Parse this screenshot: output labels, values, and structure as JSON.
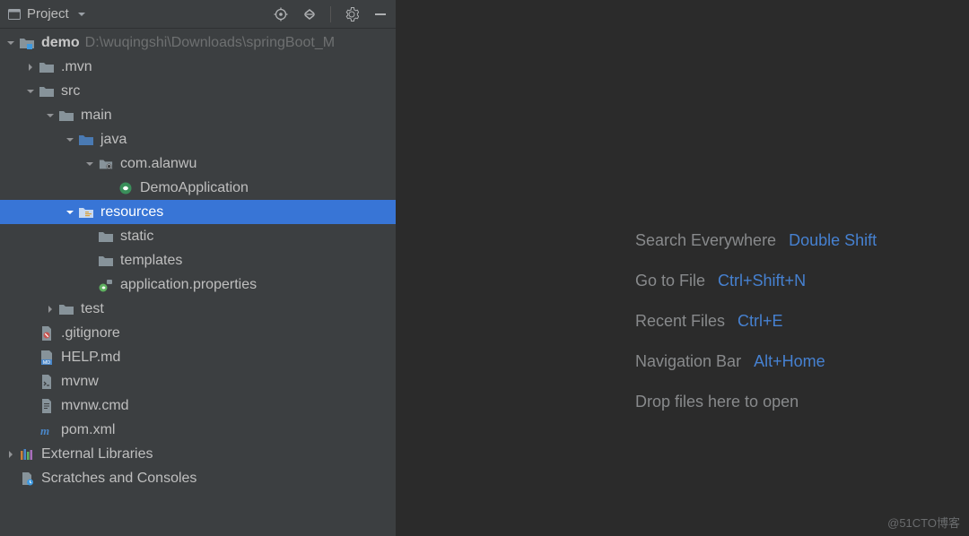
{
  "toolbar": {
    "title": "Project"
  },
  "tree": [
    {
      "indent": 0,
      "caret": "down",
      "iconKey": "module-folder",
      "label": "demo",
      "bold": true,
      "path": "D:\\wuqingshi\\Downloads\\springBoot_M"
    },
    {
      "indent": 1,
      "caret": "right",
      "iconKey": "folder",
      "label": ".mvn"
    },
    {
      "indent": 1,
      "caret": "down",
      "iconKey": "folder",
      "label": "src"
    },
    {
      "indent": 2,
      "caret": "down",
      "iconKey": "folder",
      "label": "main"
    },
    {
      "indent": 3,
      "caret": "down",
      "iconKey": "source-folder",
      "label": "java"
    },
    {
      "indent": 4,
      "caret": "down",
      "iconKey": "package",
      "label": "com.alanwu"
    },
    {
      "indent": 5,
      "caret": "none",
      "iconKey": "spring-class",
      "label": "DemoApplication"
    },
    {
      "indent": 3,
      "caret": "down",
      "iconKey": "resources-folder",
      "label": "resources",
      "selected": true
    },
    {
      "indent": 4,
      "caret": "none",
      "iconKey": "folder",
      "label": "static"
    },
    {
      "indent": 4,
      "caret": "none",
      "iconKey": "folder",
      "label": "templates"
    },
    {
      "indent": 4,
      "caret": "none",
      "iconKey": "spring-props",
      "label": "application.properties"
    },
    {
      "indent": 2,
      "caret": "right",
      "iconKey": "folder",
      "label": "test"
    },
    {
      "indent": 1,
      "caret": "none",
      "iconKey": "gitignore",
      "label": ".gitignore"
    },
    {
      "indent": 1,
      "caret": "none",
      "iconKey": "md",
      "label": "HELP.md"
    },
    {
      "indent": 1,
      "caret": "none",
      "iconKey": "shell",
      "label": "mvnw"
    },
    {
      "indent": 1,
      "caret": "none",
      "iconKey": "file",
      "label": "mvnw.cmd"
    },
    {
      "indent": 1,
      "caret": "none",
      "iconKey": "maven",
      "label": "pom.xml"
    },
    {
      "indent": 0,
      "caret": "right",
      "iconKey": "libraries",
      "label": "External Libraries"
    },
    {
      "indent": 0,
      "caret": "none",
      "iconKey": "scratches",
      "label": "Scratches and Consoles"
    }
  ],
  "tips": [
    {
      "label": "Search Everywhere",
      "key": "Double Shift"
    },
    {
      "label": "Go to File",
      "key": "Ctrl+Shift+N"
    },
    {
      "label": "Recent Files",
      "key": "Ctrl+E"
    },
    {
      "label": "Navigation Bar",
      "key": "Alt+Home"
    },
    {
      "label": "Drop files here to open",
      "key": ""
    }
  ],
  "watermark": "@51CTO博客"
}
